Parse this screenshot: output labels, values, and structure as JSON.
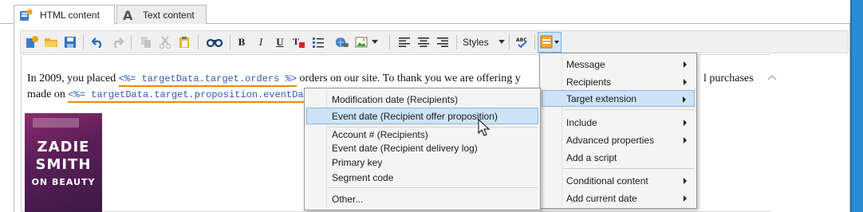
{
  "tabs": [
    {
      "label": "HTML content",
      "icon": "html-content-icon",
      "active": true
    },
    {
      "label": "Text content",
      "icon": "text-content-icon",
      "active": false
    }
  ],
  "toolbar": {
    "styles_label": "Styles",
    "buttons": [
      "insert-icon",
      "open-folder-icon",
      "save-icon",
      "undo-icon",
      "redo-icon",
      "copy-icon",
      "cut-icon",
      "paste-icon",
      "find-icon",
      "bold-icon",
      "italic-icon",
      "underline-icon",
      "text-color-icon",
      "list-icon",
      "link-icon",
      "image-icon",
      "align-left-icon",
      "align-center-icon",
      "align-right-icon",
      "spellcheck-icon",
      "personalization-icon"
    ],
    "bold_glyph": "B",
    "italic_glyph": "I",
    "underline_glyph": "U",
    "spell_glyph": "ABC"
  },
  "content": {
    "line1_a": "In 2009, you placed ",
    "line1_tag": "<%= targetData.target.orders %>",
    "line1_b": " orders on our site. To thank you we are offering y",
    "line1_c": "l purchases",
    "line2_a": "made on ",
    "line2_tag": "<%= targetData.target.proposition.eventDat",
    "book": {
      "line1": "ZADIE",
      "line2": "SMITH",
      "line3": "ON BEAUTY"
    }
  },
  "main_menu": {
    "items": [
      {
        "label": "Message",
        "submenu": true
      },
      {
        "label": "Recipients",
        "submenu": true
      },
      {
        "label": "Target extension",
        "submenu": true,
        "highlighted": true
      },
      {
        "label": "Include",
        "submenu": true
      },
      {
        "label": "Advanced properties",
        "submenu": true
      },
      {
        "label": "Add a script",
        "submenu": false
      },
      {
        "label": "Conditional content",
        "submenu": true
      },
      {
        "label": "Add current date",
        "submenu": true
      }
    ]
  },
  "sub_menu": {
    "items": [
      {
        "label": "Modification date (Recipients)"
      },
      {
        "label": "Event date (Recipient offer proposition)",
        "highlighted": true
      },
      {
        "label": "Account # (Recipients)"
      },
      {
        "label": "Event date (Recipient delivery log)"
      },
      {
        "label": "Primary key"
      },
      {
        "label": "Segment code"
      },
      {
        "label": "Other..."
      }
    ]
  },
  "colors": {
    "accent": "#2a8ad4",
    "highlight": "#cde3f7",
    "tag_underline": "#e8890c"
  }
}
